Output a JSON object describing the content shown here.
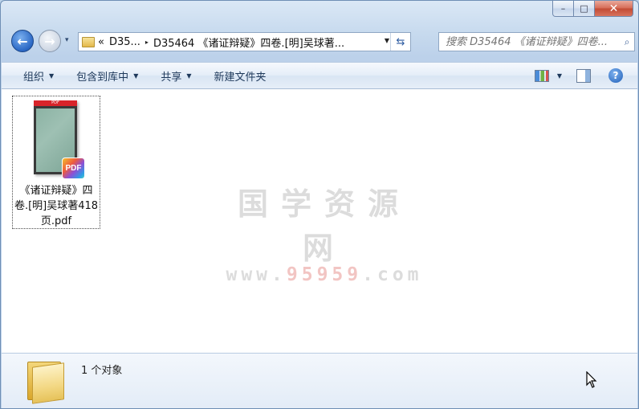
{
  "window": {
    "caption_buttons": {
      "minimize": "–",
      "maximize": "□",
      "close": "✕"
    }
  },
  "nav": {
    "back_glyph": "←",
    "forward_glyph": "→",
    "dropdown_glyph": "▾",
    "address": {
      "overflow": "«",
      "segment1": "D35...",
      "separator": "▸",
      "segment2": "D35464 《诸证辩疑》四卷.[明]吴球著...",
      "drop_glyph": "▼",
      "refresh_glyph": "⇆"
    },
    "search": {
      "placeholder": "搜索 D35464 《诸证辩疑》四卷...",
      "icon": "search-icon",
      "icon_glyph": "⌕"
    }
  },
  "toolbar": {
    "organize": "组织",
    "include_library": "包含到库中",
    "share": "共享",
    "new_folder": "新建文件夹",
    "caret": "▼",
    "help": "?"
  },
  "content": {
    "files": [
      {
        "name": "《诸证辩疑》四卷.[明]吴球著418页.pdf",
        "thumb_band": "PDF",
        "badge": "PDF"
      }
    ],
    "watermark": {
      "title": "国学资源网",
      "url_prefix": "www.",
      "url_highlight": "95959",
      "url_suffix": ".com"
    }
  },
  "details": {
    "count_text": "1 个对象"
  },
  "colors": {
    "accent": "#2a67c4",
    "close_red": "#c24a33",
    "watermark_gray": "#dcdcdc",
    "watermark_pink": "#f2c5c3"
  }
}
